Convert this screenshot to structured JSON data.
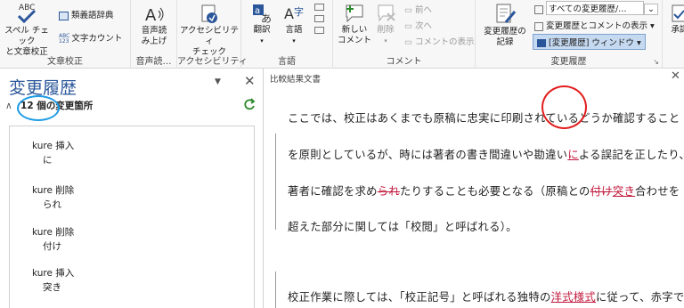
{
  "ribbon": {
    "proofing": {
      "spell_label": "スペル チェック\nと文章校正",
      "thesaurus_label": "類義語辞典",
      "wordcount_label": "文字カウント",
      "group_label": "文章校正"
    },
    "speech": {
      "read_label": "音声読\nみ上げ",
      "group_label": "音声読…"
    },
    "accessibility": {
      "check_label": "アクセシビリティ\nチェック",
      "group_label": "アクセシビリティ"
    },
    "language": {
      "translate_label": "翻訳",
      "language_label": "言語",
      "group_label": "言語"
    },
    "comments": {
      "new_label": "新しい\nコメント",
      "delete_label": "削除",
      "prev_label": "前へ",
      "next_label": "次へ",
      "show_label": "コメントの表示",
      "group_label": "コメント"
    },
    "tracking": {
      "record_label": "変更履歴の\n記録",
      "markup_select": "すべての変更履歴/…",
      "show_markup_label": "変更履歴とコメントの表示",
      "pane_label": "[変更履歴] ウィンドウ",
      "group_label": "変更履歴"
    },
    "accept_label": "承認"
  },
  "pane": {
    "title": "変更履歴",
    "summary_count": "12 個",
    "summary_text": "の変更箇所",
    "items": [
      {
        "header": "kure 挿入",
        "text": "に"
      },
      {
        "header": "kure 削除",
        "text": "られ"
      },
      {
        "header": "kure 削除",
        "text": "付け"
      },
      {
        "header": "kure 挿入",
        "text": "突き"
      }
    ]
  },
  "document": {
    "title": "比較結果文書",
    "lines": {
      "l1": "ここでは、校正はあくまでも原稿に忠実に印刷されているどうか確認すること",
      "l2_a": "を原則としているが、時には著者の書き間違いや勘違い",
      "l2_ins": "に",
      "l2_b": "よる誤記を正したり、",
      "l3_a": "著者に確認を求め",
      "l3_del": "られ",
      "l3_b": "たりすることも必要となる（原稿との",
      "l3_del2": "付け",
      "l3_ins": "突き",
      "l3_c": "合わせを",
      "l4": "超えた部分に関しては「校閲」と呼ばれる）。",
      "l5_a": "校正作業に際しては、「校正記号」と呼ばれる独特の",
      "l5_ins": "洋式様式",
      "l5_b": "に従って、赤字で"
    }
  },
  "colors": {
    "accent": "#2b579a",
    "revision": "#c1183b",
    "annot_blue": "#1d9be5",
    "annot_red": "#e21d1d"
  }
}
